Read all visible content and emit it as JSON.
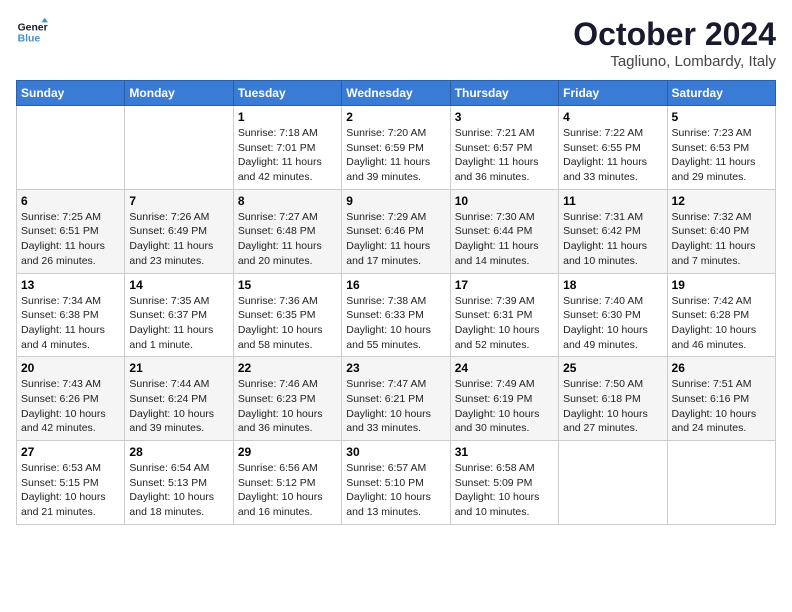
{
  "header": {
    "logo_line1": "General",
    "logo_line2": "Blue",
    "month": "October 2024",
    "location": "Tagliuno, Lombardy, Italy"
  },
  "weekdays": [
    "Sunday",
    "Monday",
    "Tuesday",
    "Wednesday",
    "Thursday",
    "Friday",
    "Saturday"
  ],
  "weeks": [
    [
      {
        "day": "",
        "info": ""
      },
      {
        "day": "",
        "info": ""
      },
      {
        "day": "1",
        "info": "Sunrise: 7:18 AM\nSunset: 7:01 PM\nDaylight: 11 hours and 42 minutes."
      },
      {
        "day": "2",
        "info": "Sunrise: 7:20 AM\nSunset: 6:59 PM\nDaylight: 11 hours and 39 minutes."
      },
      {
        "day": "3",
        "info": "Sunrise: 7:21 AM\nSunset: 6:57 PM\nDaylight: 11 hours and 36 minutes."
      },
      {
        "day": "4",
        "info": "Sunrise: 7:22 AM\nSunset: 6:55 PM\nDaylight: 11 hours and 33 minutes."
      },
      {
        "day": "5",
        "info": "Sunrise: 7:23 AM\nSunset: 6:53 PM\nDaylight: 11 hours and 29 minutes."
      }
    ],
    [
      {
        "day": "6",
        "info": "Sunrise: 7:25 AM\nSunset: 6:51 PM\nDaylight: 11 hours and 26 minutes."
      },
      {
        "day": "7",
        "info": "Sunrise: 7:26 AM\nSunset: 6:49 PM\nDaylight: 11 hours and 23 minutes."
      },
      {
        "day": "8",
        "info": "Sunrise: 7:27 AM\nSunset: 6:48 PM\nDaylight: 11 hours and 20 minutes."
      },
      {
        "day": "9",
        "info": "Sunrise: 7:29 AM\nSunset: 6:46 PM\nDaylight: 11 hours and 17 minutes."
      },
      {
        "day": "10",
        "info": "Sunrise: 7:30 AM\nSunset: 6:44 PM\nDaylight: 11 hours and 14 minutes."
      },
      {
        "day": "11",
        "info": "Sunrise: 7:31 AM\nSunset: 6:42 PM\nDaylight: 11 hours and 10 minutes."
      },
      {
        "day": "12",
        "info": "Sunrise: 7:32 AM\nSunset: 6:40 PM\nDaylight: 11 hours and 7 minutes."
      }
    ],
    [
      {
        "day": "13",
        "info": "Sunrise: 7:34 AM\nSunset: 6:38 PM\nDaylight: 11 hours and 4 minutes."
      },
      {
        "day": "14",
        "info": "Sunrise: 7:35 AM\nSunset: 6:37 PM\nDaylight: 11 hours and 1 minute."
      },
      {
        "day": "15",
        "info": "Sunrise: 7:36 AM\nSunset: 6:35 PM\nDaylight: 10 hours and 58 minutes."
      },
      {
        "day": "16",
        "info": "Sunrise: 7:38 AM\nSunset: 6:33 PM\nDaylight: 10 hours and 55 minutes."
      },
      {
        "day": "17",
        "info": "Sunrise: 7:39 AM\nSunset: 6:31 PM\nDaylight: 10 hours and 52 minutes."
      },
      {
        "day": "18",
        "info": "Sunrise: 7:40 AM\nSunset: 6:30 PM\nDaylight: 10 hours and 49 minutes."
      },
      {
        "day": "19",
        "info": "Sunrise: 7:42 AM\nSunset: 6:28 PM\nDaylight: 10 hours and 46 minutes."
      }
    ],
    [
      {
        "day": "20",
        "info": "Sunrise: 7:43 AM\nSunset: 6:26 PM\nDaylight: 10 hours and 42 minutes."
      },
      {
        "day": "21",
        "info": "Sunrise: 7:44 AM\nSunset: 6:24 PM\nDaylight: 10 hours and 39 minutes."
      },
      {
        "day": "22",
        "info": "Sunrise: 7:46 AM\nSunset: 6:23 PM\nDaylight: 10 hours and 36 minutes."
      },
      {
        "day": "23",
        "info": "Sunrise: 7:47 AM\nSunset: 6:21 PM\nDaylight: 10 hours and 33 minutes."
      },
      {
        "day": "24",
        "info": "Sunrise: 7:49 AM\nSunset: 6:19 PM\nDaylight: 10 hours and 30 minutes."
      },
      {
        "day": "25",
        "info": "Sunrise: 7:50 AM\nSunset: 6:18 PM\nDaylight: 10 hours and 27 minutes."
      },
      {
        "day": "26",
        "info": "Sunrise: 7:51 AM\nSunset: 6:16 PM\nDaylight: 10 hours and 24 minutes."
      }
    ],
    [
      {
        "day": "27",
        "info": "Sunrise: 6:53 AM\nSunset: 5:15 PM\nDaylight: 10 hours and 21 minutes."
      },
      {
        "day": "28",
        "info": "Sunrise: 6:54 AM\nSunset: 5:13 PM\nDaylight: 10 hours and 18 minutes."
      },
      {
        "day": "29",
        "info": "Sunrise: 6:56 AM\nSunset: 5:12 PM\nDaylight: 10 hours and 16 minutes."
      },
      {
        "day": "30",
        "info": "Sunrise: 6:57 AM\nSunset: 5:10 PM\nDaylight: 10 hours and 13 minutes."
      },
      {
        "day": "31",
        "info": "Sunrise: 6:58 AM\nSunset: 5:09 PM\nDaylight: 10 hours and 10 minutes."
      },
      {
        "day": "",
        "info": ""
      },
      {
        "day": "",
        "info": ""
      }
    ]
  ]
}
